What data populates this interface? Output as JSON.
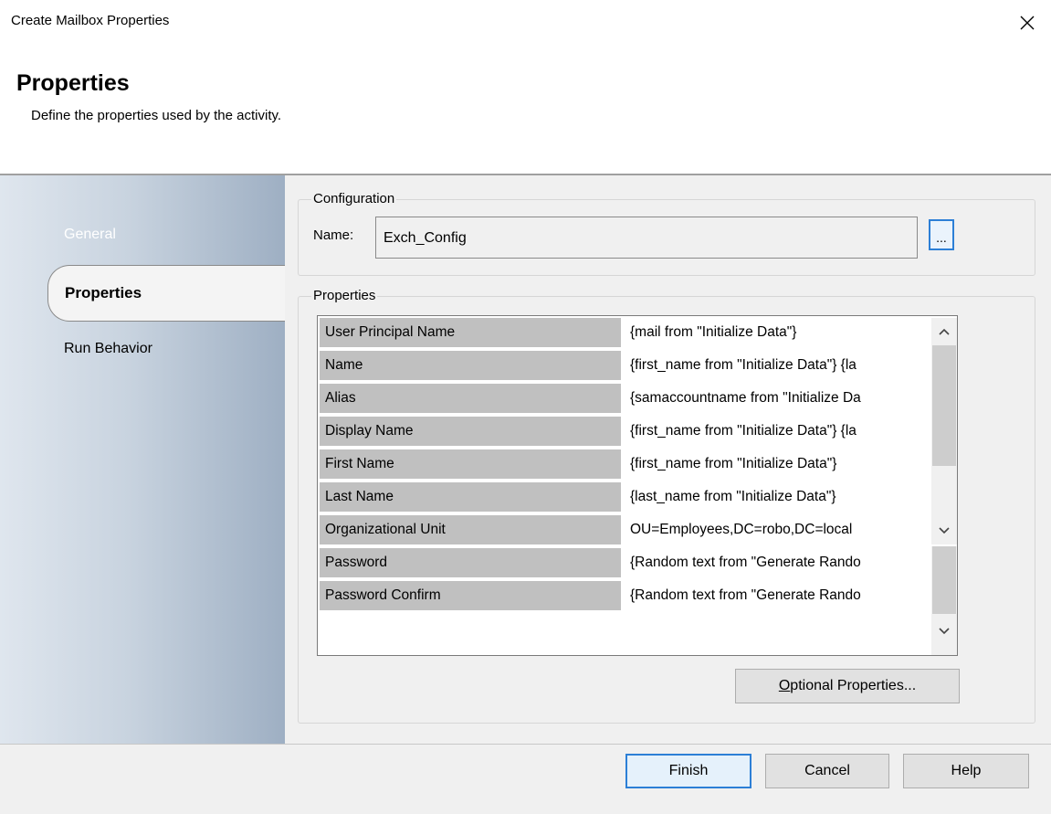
{
  "window": {
    "title": "Create Mailbox Properties",
    "close_icon": "close-icon"
  },
  "header": {
    "heading": "Properties",
    "description": "Define the properties used by the activity."
  },
  "sidebar": {
    "items": [
      {
        "label": "General",
        "selected": false
      },
      {
        "label": "Properties",
        "selected": true
      },
      {
        "label": "Run Behavior",
        "selected": false
      }
    ]
  },
  "configuration": {
    "legend": "Configuration",
    "name_label": "Name:",
    "name_value": "Exch_Config",
    "browse_label": "..."
  },
  "properties": {
    "legend": "Properties",
    "rows": [
      {
        "name": "User Principal Name",
        "value": "{mail from \"Initialize Data\"}"
      },
      {
        "name": "Name",
        "value": "{first_name from \"Initialize Data\"} {la"
      },
      {
        "name": "Alias",
        "value": "{samaccountname from \"Initialize Da"
      },
      {
        "name": "Display Name",
        "value": "{first_name from \"Initialize Data\"} {la"
      },
      {
        "name": "First Name",
        "value": "{first_name from \"Initialize Data\"}"
      },
      {
        "name": "Last Name",
        "value": "{last_name from \"Initialize Data\"}"
      },
      {
        "name": "Organizational Unit",
        "value": "OU=Employees,DC=robo,DC=local"
      },
      {
        "name": "Password",
        "value": "{Random text from \"Generate Rando"
      },
      {
        "name": "Password Confirm",
        "value": "{Random text from \"Generate Rando"
      }
    ],
    "optional_button": {
      "mnemonic": "O",
      "rest": "ptional Properties..."
    }
  },
  "footer": {
    "finish_label": "Finish",
    "cancel_label": "Cancel",
    "help_label": "Help"
  },
  "colors": {
    "accent": "#2c7fd6",
    "name_cell_bg": "#c0c0c0",
    "sidebar_gradient_end": "#9eafc3"
  }
}
